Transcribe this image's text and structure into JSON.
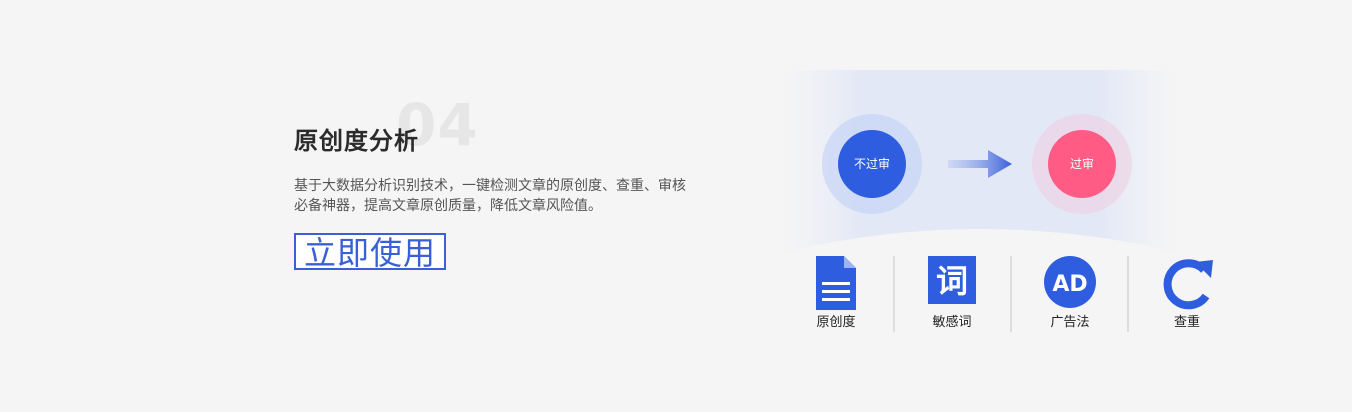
{
  "feature": {
    "number": "04",
    "title": "原创度分析",
    "description": "基于大数据分析识别技术，一键检测文章的原创度、查重、审核必备神器，提高文章原创质量，降低文章风险值。",
    "cta_label": "立即使用"
  },
  "flow": {
    "before_label": "不过审",
    "after_label": "过审"
  },
  "tools": [
    {
      "label": "原创度",
      "icon": "document-icon"
    },
    {
      "label": "敏感词",
      "icon": "sensitive-word-icon",
      "glyph": "词"
    },
    {
      "label": "广告法",
      "icon": "ad-icon",
      "glyph": "AD"
    },
    {
      "label": "查重",
      "icon": "refresh-icon"
    }
  ],
  "colors": {
    "accent": "#2f5de0",
    "pink": "#ff5b85",
    "title": "#2b2b2b",
    "background": "#f5f5f5"
  }
}
